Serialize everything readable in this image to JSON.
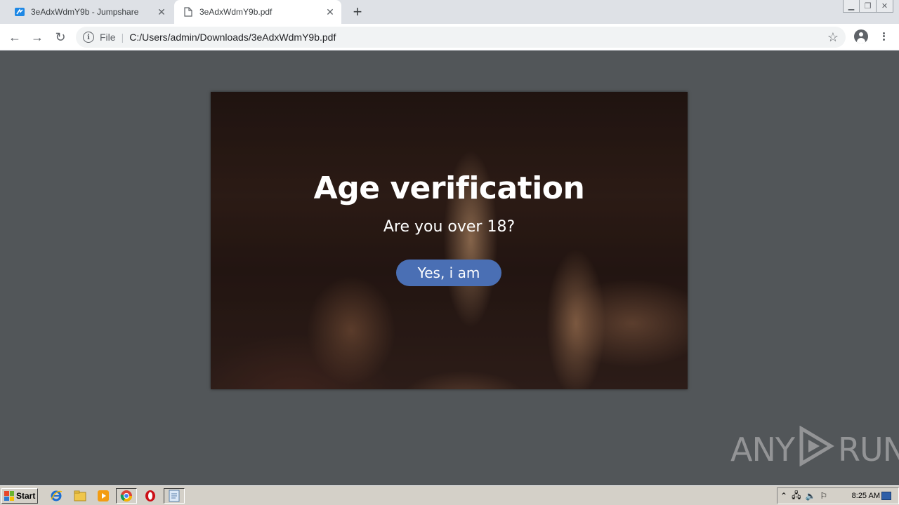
{
  "browser": {
    "tabs": [
      {
        "title": "3eAdxWdmY9b - Jumpshare",
        "active": false
      },
      {
        "title": "3eAdxWdmY9b.pdf",
        "active": true
      }
    ],
    "address": {
      "scheme_label": "File",
      "url": "C:/Users/admin/Downloads/3eAdxWdmY9b.pdf"
    }
  },
  "pdf": {
    "title": "Age verification",
    "question": "Are you over 18?",
    "button_label": "Yes, i am",
    "button_color": "#4a6fb4"
  },
  "watermark": {
    "left": "ANY",
    "right": "RUN"
  },
  "taskbar": {
    "start_label": "Start",
    "clock": "8:25 AM",
    "pinned": [
      "ie-icon",
      "explorer-icon",
      "media-player-icon",
      "chrome-icon",
      "opera-icon",
      "notepad-icon"
    ]
  }
}
